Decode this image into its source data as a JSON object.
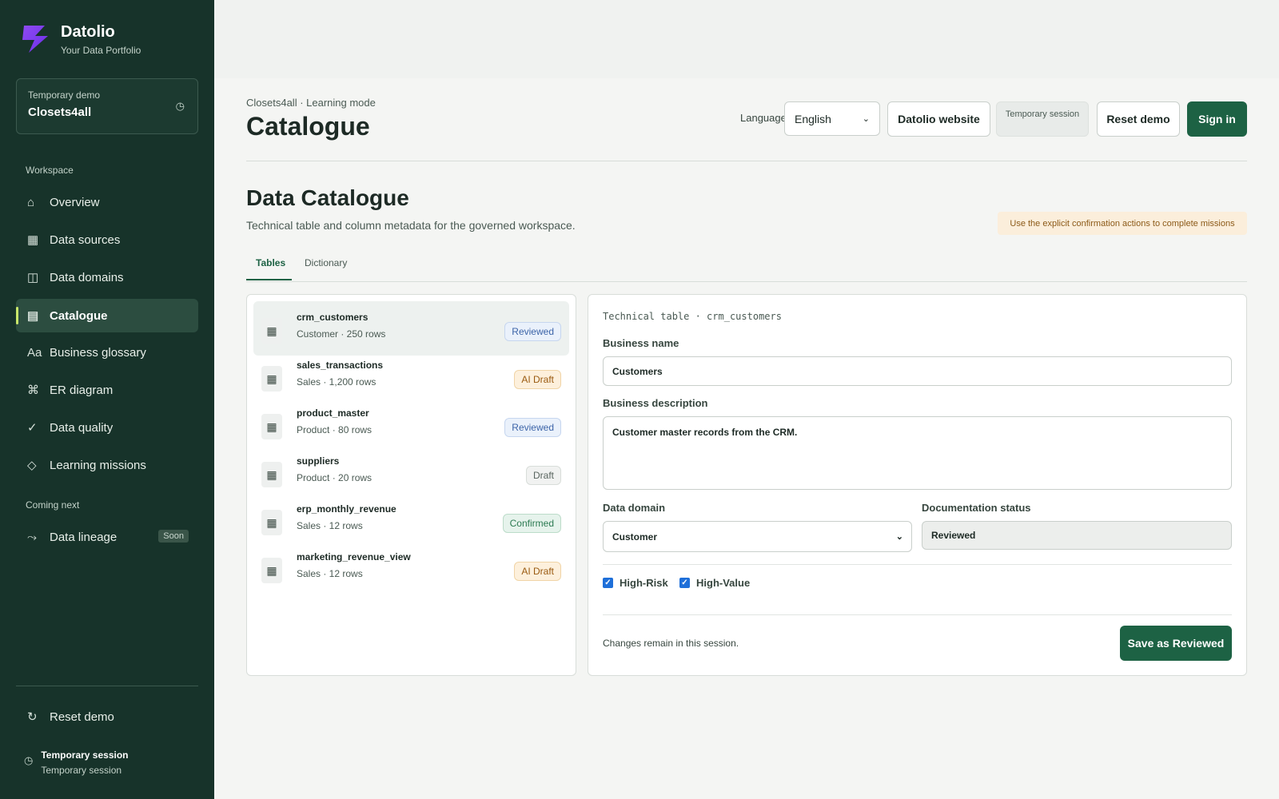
{
  "brand": {
    "name": "Datolio",
    "tagline": "Your Data Portfolio"
  },
  "demo_card": {
    "label": "Temporary demo",
    "name": "Closets4all"
  },
  "sidebar": {
    "workspace_label": "Workspace",
    "items": [
      {
        "label": "Overview",
        "icon": "home-icon"
      },
      {
        "label": "Data sources",
        "icon": "grid-icon"
      },
      {
        "label": "Data domains",
        "icon": "columns-icon"
      },
      {
        "label": "Catalogue",
        "icon": "catalogue-icon",
        "active": true
      },
      {
        "label": "Business glossary",
        "icon": "glossary-icon"
      },
      {
        "label": "ER diagram",
        "icon": "command-icon"
      },
      {
        "label": "Data quality",
        "icon": "check-icon"
      },
      {
        "label": "Learning missions",
        "icon": "diamond-icon"
      }
    ],
    "coming_next_label": "Coming next",
    "coming": {
      "label": "Data lineage",
      "badge": "Soon",
      "icon": "lineage-icon"
    },
    "reset_label": "Reset demo",
    "session_title": "Temporary session",
    "session_sub": "Temporary session"
  },
  "header": {
    "breadcrumb": "Closets4all · Learning mode",
    "title": "Catalogue",
    "language_label": "Language",
    "language_value": "English",
    "website_button": "Datolio website",
    "session_pill": "Temporary session",
    "reset_button": "Reset demo",
    "signin_button": "Sign in"
  },
  "main": {
    "title": "Data Catalogue",
    "description": "Technical table and column metadata for the governed workspace.",
    "hint": "Use the explicit confirmation actions to complete missions",
    "tabs": [
      {
        "label": "Tables",
        "active": true
      },
      {
        "label": "Dictionary"
      }
    ]
  },
  "tables": [
    {
      "name": "crm_customers",
      "meta": "Customer · 250 rows",
      "status": "Reviewed",
      "status_kind": "reviewed",
      "selected": true
    },
    {
      "name": "sales_transactions",
      "meta": "Sales · 1,200 rows",
      "status": "AI Draft",
      "status_kind": "aidraft"
    },
    {
      "name": "product_master",
      "meta": "Product · 80 rows",
      "status": "Reviewed",
      "status_kind": "reviewed"
    },
    {
      "name": "suppliers",
      "meta": "Product · 20 rows",
      "status": "Draft",
      "status_kind": "draft"
    },
    {
      "name": "erp_monthly_revenue",
      "meta": "Sales · 12 rows",
      "status": "Confirmed",
      "status_kind": "confirmed"
    },
    {
      "name": "marketing_revenue_view",
      "meta": "Sales · 12 rows",
      "status": "AI Draft",
      "status_kind": "aidraft"
    }
  ],
  "detail": {
    "technical_title": "Technical table · crm_customers",
    "business_name_label": "Business name",
    "business_name_value": "Customers",
    "business_desc_label": "Business description",
    "business_desc_value": "Customer master records from the CRM.",
    "domain_label": "Data domain",
    "domain_value": "Customer",
    "status_label": "Documentation status",
    "status_value": "Reviewed",
    "high_risk_label": "High-Risk",
    "high_risk_checked": true,
    "high_value_label": "High-Value",
    "high_value_checked": true,
    "footer_note": "Changes remain in this session.",
    "save_button": "Save as Reviewed"
  },
  "colors": {
    "sidebar_bg": "#17332a",
    "accent": "#1d6244",
    "active_marker": "#c8e76a"
  }
}
